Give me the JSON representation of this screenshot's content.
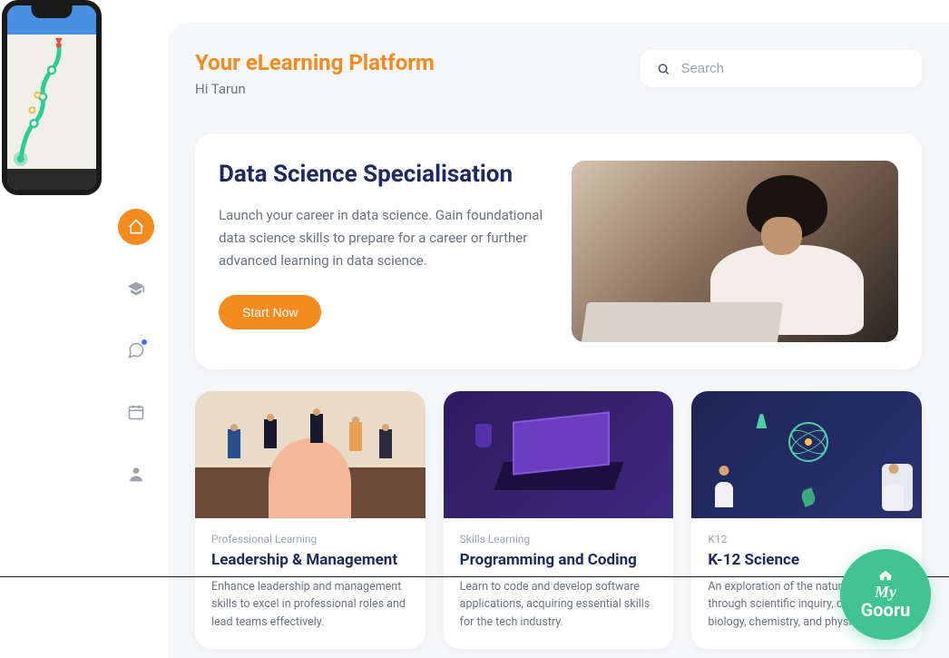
{
  "header": {
    "title": "Your eLearning Platform",
    "greeting": "Hi Tarun"
  },
  "search": {
    "placeholder": "Search"
  },
  "hero": {
    "title": "Data Science Specialisation",
    "description": "Launch your career in data science. Gain foundational data science skills to prepare for a career or further advanced learning in data science.",
    "button_label": "Start Now"
  },
  "cards": [
    {
      "category": "Professional Learning",
      "title": "Leadership & Management",
      "description": "Enhance leadership and management skills to excel in professional roles and lead teams effectively."
    },
    {
      "category": "Skills Learning",
      "title": "Programming and Coding",
      "description": "Learn to code and develop software applications, acquiring essential skills for the tech industry."
    },
    {
      "category": "K12",
      "title": "K-12 Science",
      "description": "An exploration of the natural world through scientific inquiry, covering biology, chemistry, and physics."
    }
  ],
  "badge": {
    "line1": "My",
    "line2": "Gooru"
  },
  "nav": {
    "items": [
      "home",
      "education",
      "chat",
      "calendar",
      "profile"
    ]
  }
}
